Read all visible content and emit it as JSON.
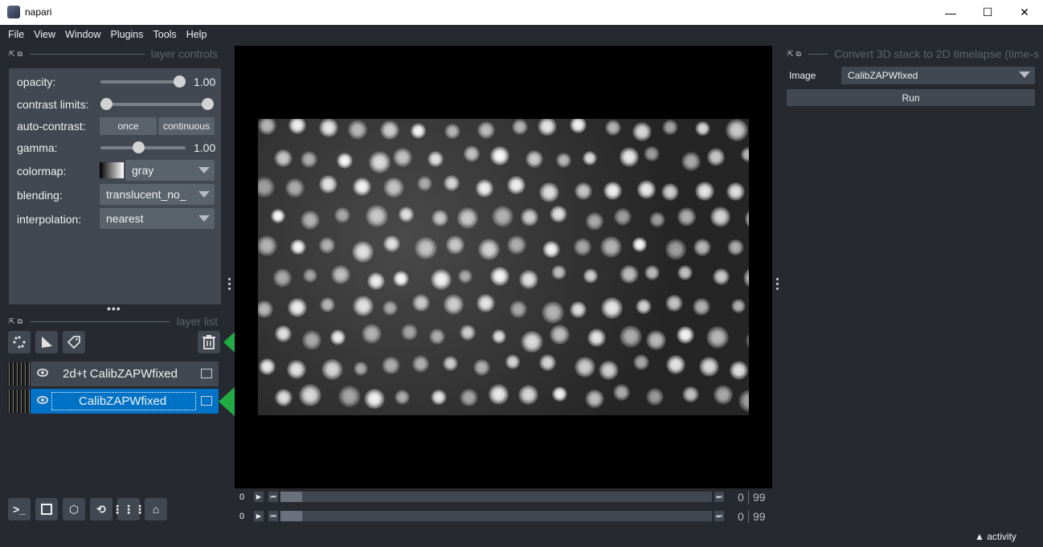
{
  "window": {
    "title": "napari",
    "minimize": "—",
    "maximize": "☐",
    "close": "✕"
  },
  "menu": [
    "File",
    "View",
    "Window",
    "Plugins",
    "Tools",
    "Help"
  ],
  "layer_controls": {
    "header": "layer controls",
    "opacity_label": "opacity:",
    "opacity_value": "1.00",
    "opacity": 1.0,
    "contrast_label": "contrast limits:",
    "contrast_limits": [
      0.0,
      1.0
    ],
    "auto_contrast_label": "auto-contrast:",
    "once_label": "once",
    "continuous_label": "continuous",
    "gamma_label": "gamma:",
    "gamma_value": "1.00",
    "gamma": 1.0,
    "colormap_label": "colormap:",
    "colormap_value": "gray",
    "blending_label": "blending:",
    "blending_value": "translucent_no_",
    "interpolation_label": "interpolation:",
    "interpolation_value": "nearest"
  },
  "layer_list": {
    "header": "layer list",
    "layers": [
      {
        "name": "2d+t CalibZAPWfixed",
        "selected": false
      },
      {
        "name": "CalibZAPWfixed",
        "selected": true
      }
    ]
  },
  "dims": [
    {
      "label": "0",
      "current": "0",
      "max": "99"
    },
    {
      "label": "0",
      "current": "0",
      "max": "99"
    }
  ],
  "plugin": {
    "header": "Convert 3D stack to 2D timelapse (time-s",
    "image_label": "Image",
    "image_value": "CalibZAPWfixed",
    "run_label": "Run"
  },
  "status": {
    "activity": "activity"
  },
  "colors": {
    "accent": "#0072c6",
    "arrow": "#22aa44",
    "bg": "#262930",
    "panel": "#414851"
  }
}
